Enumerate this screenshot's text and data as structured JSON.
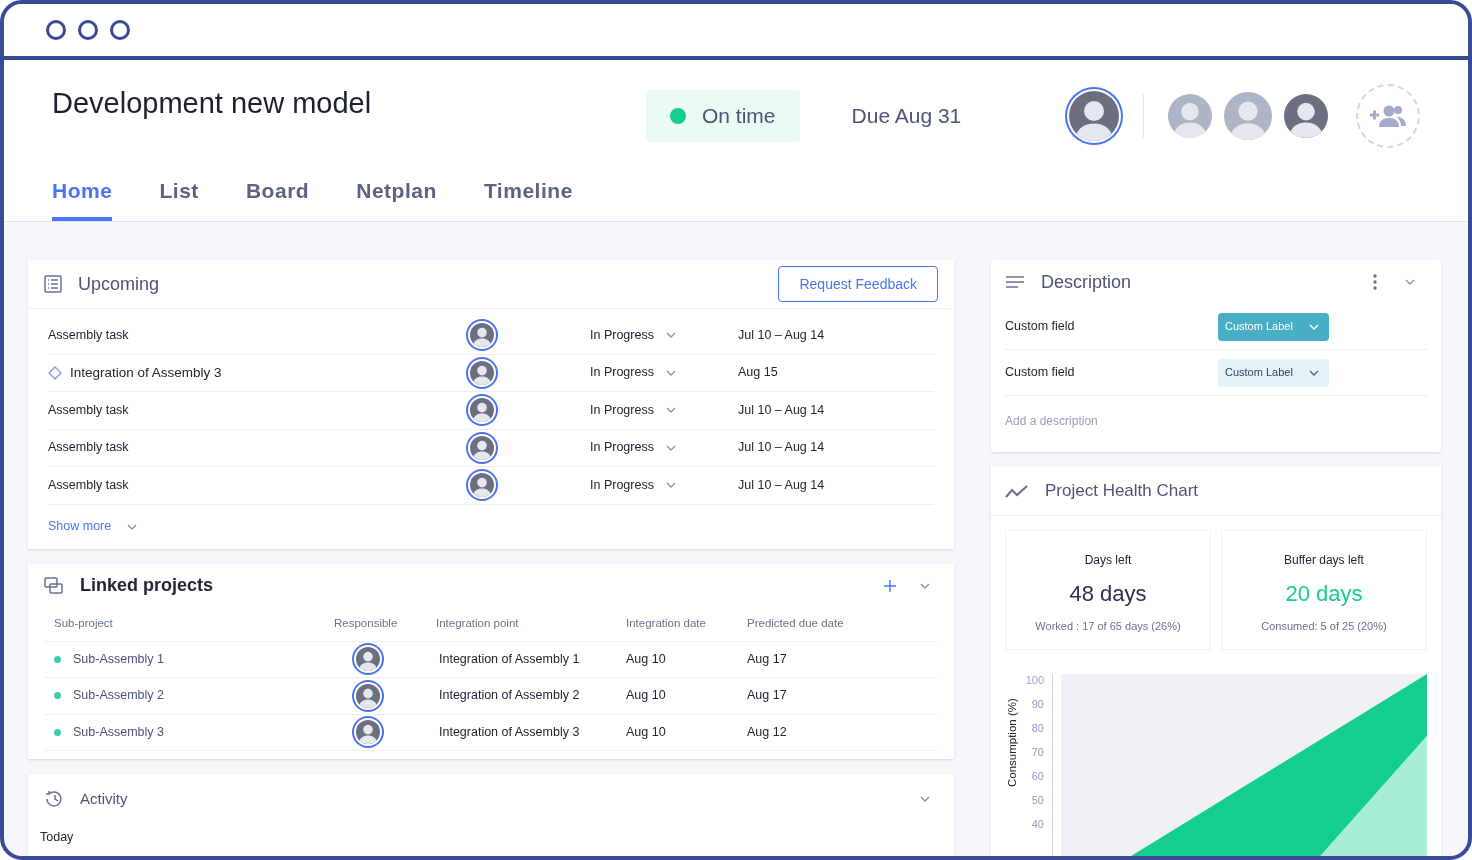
{
  "header": {
    "title": "Development new model",
    "status": {
      "label": "On time",
      "color": "#13ce8f"
    },
    "due": "Due Aug 31"
  },
  "tabs": [
    {
      "label": "Home",
      "selected": true
    },
    {
      "label": "List",
      "selected": false
    },
    {
      "label": "Board",
      "selected": false
    },
    {
      "label": "Netplan",
      "selected": false
    },
    {
      "label": "Timeline",
      "selected": false
    }
  ],
  "upcoming": {
    "title": "Upcoming",
    "button": "Request Feedback",
    "rows": [
      {
        "kind": "task",
        "name": "Assembly task",
        "status": "In Progress",
        "dates": "Jul 10 – Aug 14"
      },
      {
        "kind": "milestone",
        "name": "Integration of Assembly 3",
        "status": "In Progress",
        "dates": "Aug 15"
      },
      {
        "kind": "task",
        "name": "Assembly task",
        "status": "In Progress",
        "dates": "Jul 10 – Aug 14"
      },
      {
        "kind": "task",
        "name": "Assembly task",
        "status": "In Progress",
        "dates": "Jul 10 – Aug 14"
      },
      {
        "kind": "task",
        "name": "Assembly task",
        "status": "In Progress",
        "dates": "Jul 10 – Aug 14"
      }
    ],
    "show_more": "Show more"
  },
  "linked": {
    "title": "Linked projects",
    "columns": [
      "Sub-project",
      "Responsible",
      "Integration point",
      "Integration date",
      "Predicted due date"
    ],
    "rows": [
      {
        "name": "Sub-Assembly 1",
        "color": "#3cc9b0",
        "point": "Integration of Assembly 1",
        "date": "Aug 10",
        "due": "Aug 17"
      },
      {
        "name": "Sub-Assembly 2",
        "color": "#3cc9b0",
        "point": "Integration of Assembly 2",
        "date": "Aug 10",
        "due": "Aug 17"
      },
      {
        "name": "Sub-Assembly 3",
        "color": "#3cc9b0",
        "point": "Integration of Assembly 3",
        "date": "Aug 10",
        "due": "Aug 12"
      }
    ]
  },
  "activity": {
    "title": "Activity",
    "group": "Today"
  },
  "description": {
    "title": "Description",
    "fields": [
      {
        "label": "Custom field",
        "value": "Custom Label",
        "selected": true
      },
      {
        "label": "Custom field",
        "value": "Custom Label",
        "selected": false
      }
    ],
    "placeholder": "Add a description"
  },
  "health": {
    "title": "Project Health Chart",
    "stats": [
      {
        "title": "Days left",
        "value": "48 days",
        "kind": "neutral",
        "note": "Worked : 17 of 65 days (26%)"
      },
      {
        "title": "Buffer days left",
        "value": "20 days",
        "kind": "good",
        "note": "Consumed: 5 of 25 (20%)"
      }
    ],
    "chart": {
      "ylabel": "Consumption (%)",
      "yticks": [
        "100",
        "90",
        "80",
        "70",
        "60",
        "50",
        "40"
      ]
    }
  }
}
